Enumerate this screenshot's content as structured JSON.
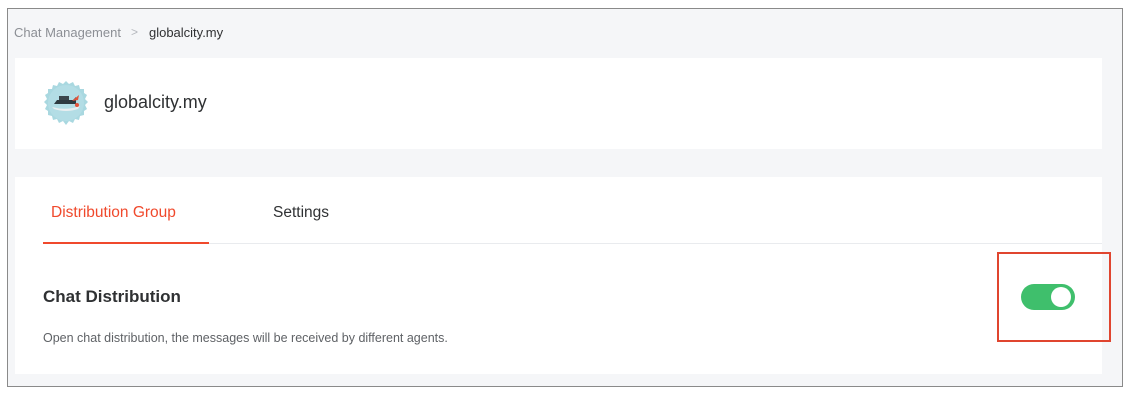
{
  "breadcrumb": {
    "parent": "Chat Management",
    "separator": ">",
    "current": "globalcity.my"
  },
  "header": {
    "avatar_icon": "ship-logo-icon",
    "site_name": "globalcity.my"
  },
  "tabs": [
    {
      "label": "Distribution Group",
      "active": true
    },
    {
      "label": "Settings",
      "active": false
    }
  ],
  "chat_distribution": {
    "title": "Chat Distribution",
    "description": "Open chat distribution, the messages will be received by different agents.",
    "enabled": true
  },
  "colors": {
    "accent": "#f0492c",
    "toggle_on": "#3fbf6c",
    "highlight": "#e0452f"
  }
}
